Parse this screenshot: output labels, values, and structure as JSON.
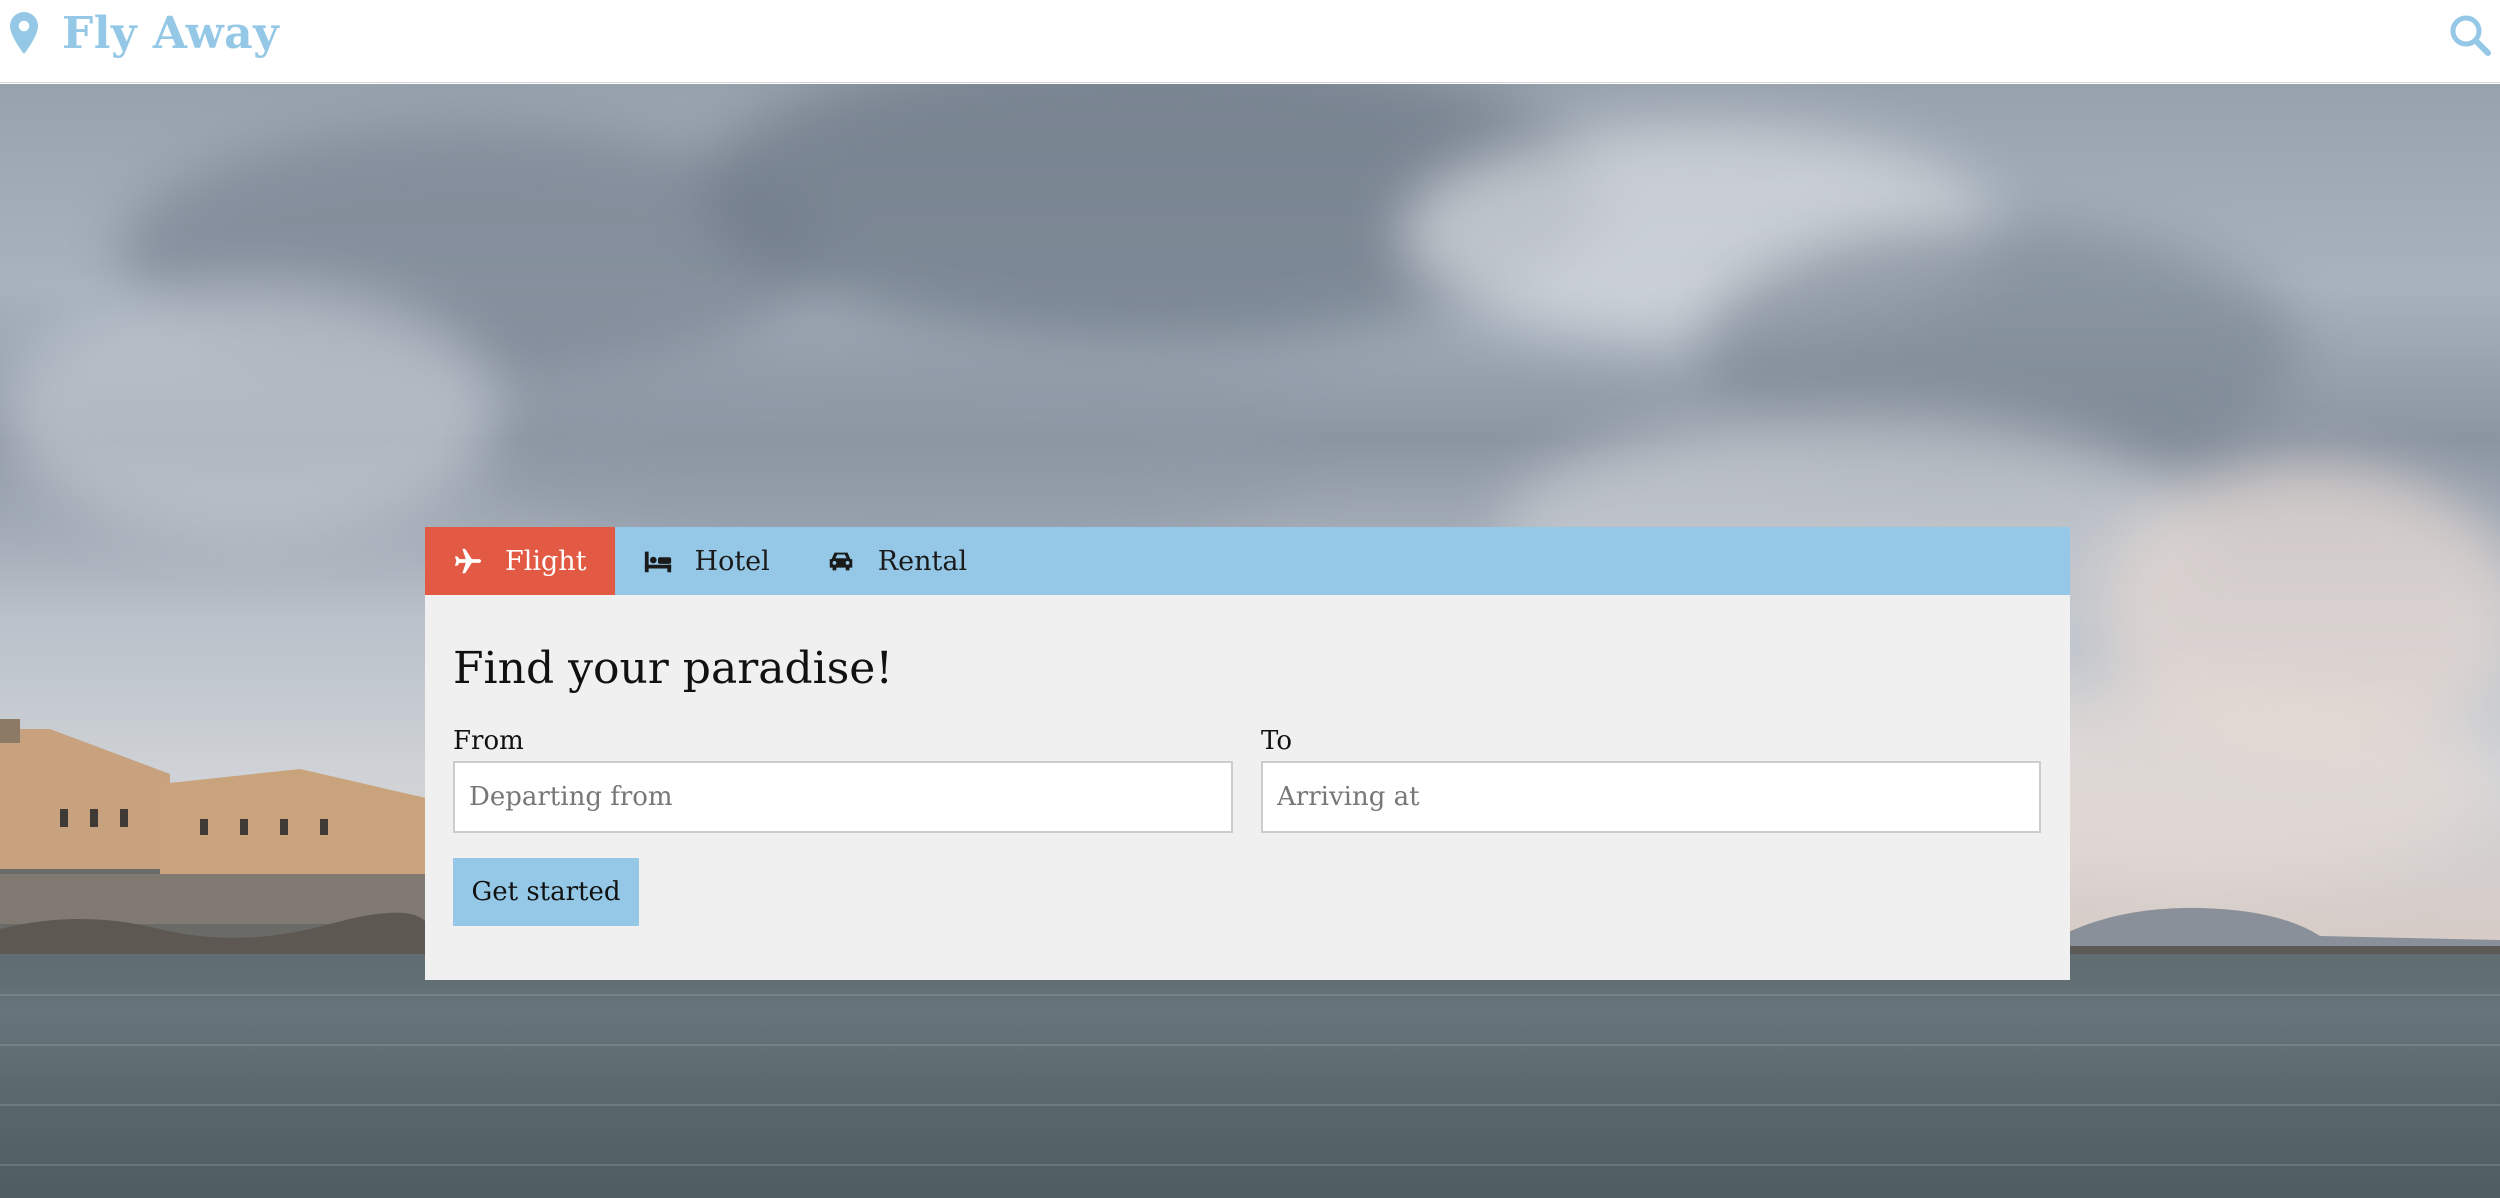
{
  "header": {
    "brand": "Fly Away",
    "logo_icon": "map-marker-icon",
    "search_icon": "search-icon",
    "accent_color": "#94c8e6"
  },
  "tabs": [
    {
      "label": "Flight",
      "icon": "plane-icon",
      "active": true
    },
    {
      "label": "Hotel",
      "icon": "bed-icon",
      "active": false
    },
    {
      "label": "Rental",
      "icon": "car-icon",
      "active": false
    }
  ],
  "form": {
    "title": "Find your paradise!",
    "from_label": "From",
    "from_placeholder": "Departing from",
    "from_value": "",
    "to_label": "To",
    "to_placeholder": "Arriving at",
    "to_value": "",
    "submit_label": "Get started"
  },
  "colors": {
    "tab_bar": "#94c8e6",
    "active_tab": "#e25a44",
    "panel_bg": "#f0f0f0",
    "button": "#94c8e6"
  }
}
